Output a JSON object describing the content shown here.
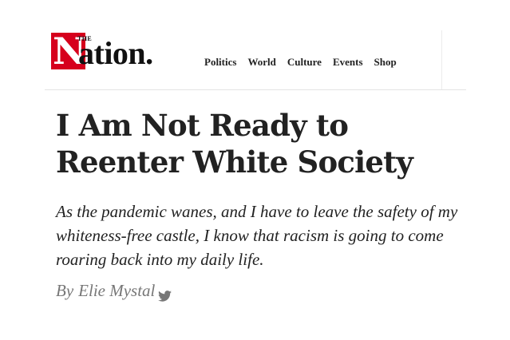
{
  "brand": {
    "logo_the": "THE",
    "logo_initial": "N",
    "logo_rest": "ation.",
    "accent_color": "#d6001c"
  },
  "nav": {
    "items": [
      {
        "label": "Politics"
      },
      {
        "label": "World"
      },
      {
        "label": "Culture"
      },
      {
        "label": "Events"
      },
      {
        "label": "Shop"
      }
    ]
  },
  "article": {
    "title": "I Am Not Ready to Reenter White Society",
    "dek": "As the pandemic wanes, and I have to leave the safety of my whiteness-free castle, I know that racism is going to come roaring back into my daily life.",
    "byline_prefix": "By",
    "author": "Elie Mystal",
    "author_social_icon": "twitter-icon"
  }
}
